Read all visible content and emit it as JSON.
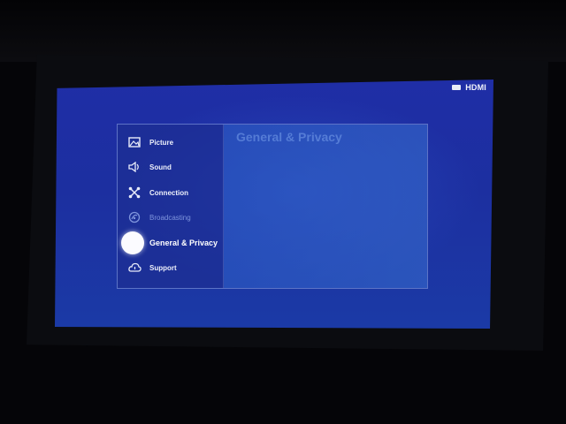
{
  "header": {
    "input_label": "HDMI",
    "input_icon": "hdmi-input-icon"
  },
  "menu": {
    "items": [
      {
        "label": "Picture",
        "icon": "picture-icon"
      },
      {
        "label": "Sound",
        "icon": "sound-icon"
      },
      {
        "label": "Connection",
        "icon": "connection-icon"
      },
      {
        "label": "Broadcasting",
        "icon": "broadcasting-icon"
      },
      {
        "label": "General & Privacy",
        "icon": "general-privacy-icon"
      },
      {
        "label": "Support",
        "icon": "support-icon"
      }
    ],
    "selected": "General & Privacy"
  },
  "content": {
    "title": "General & Privacy",
    "items": []
  },
  "colors": {
    "screen_bg": "#1f2ea6",
    "menu_text": "#eef1fb",
    "dim_text": "#7f95dd",
    "focus": "#fbfbff"
  }
}
